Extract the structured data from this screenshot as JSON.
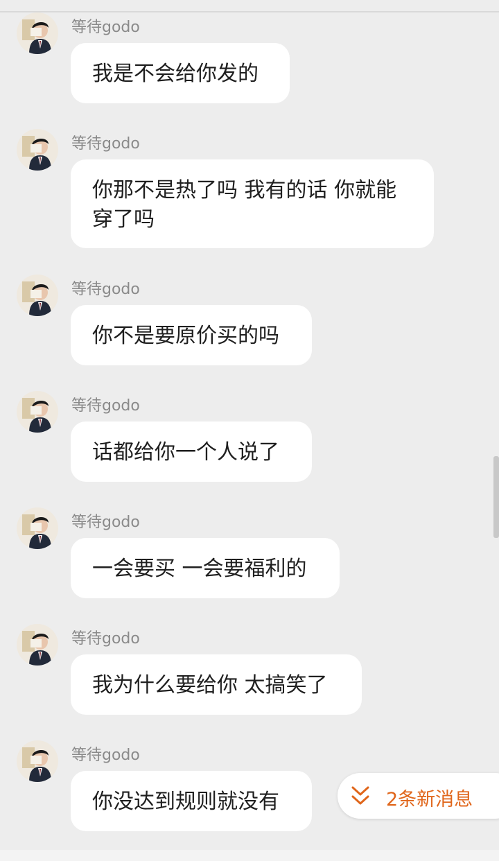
{
  "chat": {
    "messages": [
      {
        "sender": "等待godo",
        "text": "我是不会给你发的"
      },
      {
        "sender": "等待godo",
        "text": "你那不是热了吗 我有的话 你就能穿了吗"
      },
      {
        "sender": "等待godo",
        "text": "你不是要原价买的吗"
      },
      {
        "sender": "等待godo",
        "text": "话都给你一个人说了"
      },
      {
        "sender": "等待godo",
        "text": "一会要买 一会要福利的"
      },
      {
        "sender": "等待godo",
        "text": "我为什么要给你 太搞笑了"
      },
      {
        "sender": "等待godo",
        "text": "你没达到规则就没有"
      }
    ]
  },
  "new_messages": {
    "label": "2条新消息",
    "icon": "double-chevron-down-icon"
  },
  "colors": {
    "background": "#ededed",
    "bubble": "#ffffff",
    "accent": "#e0661b",
    "sender_text": "#8a8a8a"
  }
}
